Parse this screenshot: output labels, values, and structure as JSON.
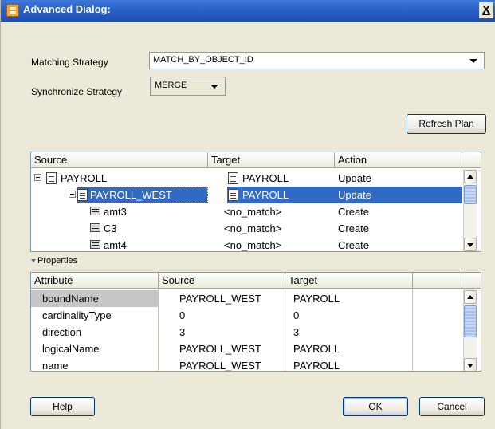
{
  "window": {
    "title": "Advanced Dialog:",
    "close_label": "X"
  },
  "form": {
    "matching_label": "Matching Strategy",
    "matching_value": "MATCH_BY_OBJECT_ID",
    "sync_label": "Synchronize Strategy",
    "sync_value": "MERGE",
    "refresh_label": "Refresh Plan"
  },
  "plan": {
    "headers": [
      "Source",
      "Target",
      "Action"
    ],
    "rows": [
      {
        "source": "PAYROLL",
        "target": "PAYROLL",
        "action": "Update"
      },
      {
        "source": "PAYROLL_WEST",
        "target": "PAYROLL",
        "action": "Update"
      },
      {
        "source": "amt3",
        "target": "<no_match>",
        "action": "Create"
      },
      {
        "source": "C3",
        "target": "<no_match>",
        "action": "Create"
      },
      {
        "source": "amt4",
        "target": "<no_match>",
        "action": "Create"
      }
    ]
  },
  "properties": {
    "label": "Properties",
    "headers": [
      "Attribute",
      "Source",
      "Target"
    ],
    "rows": [
      {
        "attribute": "boundName",
        "source": "PAYROLL_WEST",
        "target": "PAYROLL"
      },
      {
        "attribute": "cardinalityType",
        "source": "0",
        "target": "0"
      },
      {
        "attribute": "direction",
        "source": "3",
        "target": "3"
      },
      {
        "attribute": "logicalName",
        "source": "PAYROLL_WEST",
        "target": "PAYROLL"
      },
      {
        "attribute": "name",
        "source": "PAYROLL_WEST",
        "target": "PAYROLL"
      }
    ]
  },
  "buttons": {
    "help": "Help",
    "ok": "OK",
    "cancel": "Cancel"
  },
  "colors": {
    "title_bar": "#2a60c8",
    "selection": "#316ac5",
    "dialog_bg": "#ece9d8"
  }
}
